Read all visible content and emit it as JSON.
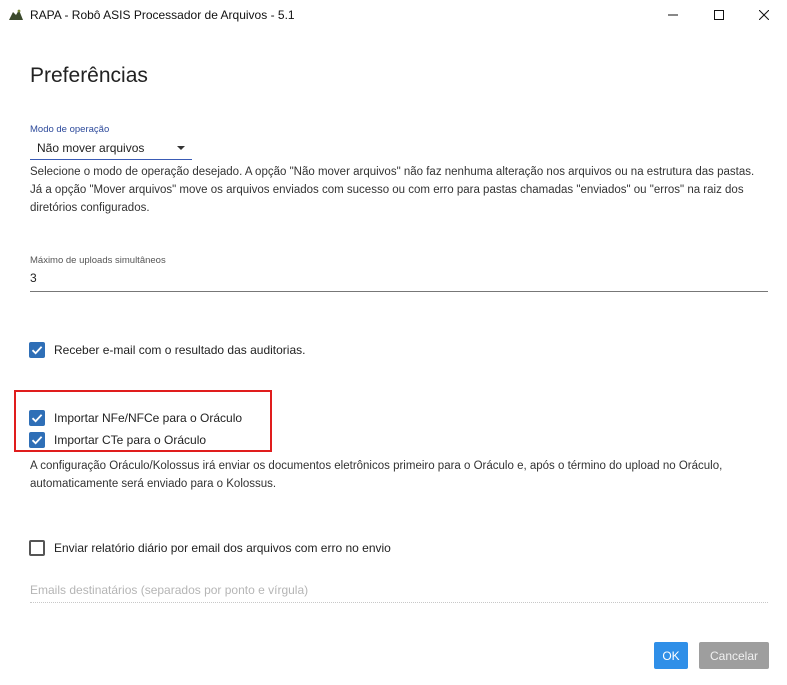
{
  "window": {
    "title": "RAPA - Robô ASIS Processador de Arquivos - 5.1",
    "icon": "rapa-app-icon",
    "controls": {
      "minimize": "minimize-icon",
      "maximize": "maximize-icon",
      "close": "close-icon"
    }
  },
  "page": {
    "title": "Preferências"
  },
  "mode": {
    "label": "Modo de operação",
    "value": "Não mover arquivos",
    "description": "Selecione o modo de operação desejado. A opção \"Não mover arquivos\" não faz nenhuma alteração nos arquivos ou na estrutura das pastas. Já a opção \"Mover arquivos\" move os arquivos enviados com sucesso ou com erro para pastas chamadas \"enviados\" ou \"erros\" na raiz dos diretórios configurados."
  },
  "uploads": {
    "label": "Máximo de uploads simultâneos",
    "value": "3"
  },
  "options": {
    "email_result": {
      "label": "Receber e-mail com o resultado das auditorias.",
      "checked": true
    },
    "import_nfe": {
      "label": "Importar NFe/NFCe para o Oráculo",
      "checked": true
    },
    "import_cte": {
      "label": "Importar CTe para o Oráculo",
      "checked": true
    },
    "daily_report": {
      "label": "Enviar relatório diário por email dos arquivos com erro no envio",
      "checked": false
    }
  },
  "oraculo_description": "A configuração Oráculo/Kolossus irá enviar os documentos eletrônicos primeiro para o Oráculo e, após o término do upload no Oráculo, automaticamente será enviado para o Kolossus.",
  "emails": {
    "placeholder": "Emails destinatários (separados por ponto e vírgula)",
    "value": ""
  },
  "buttons": {
    "ok": "OK",
    "cancel": "Cancelar"
  },
  "colors": {
    "accent": "#2f6fb7",
    "ok_button": "#2f8fe8",
    "cancel_button": "#9e9e9e",
    "highlight": "#e01d1d",
    "label_blue": "#2d4a9b"
  }
}
